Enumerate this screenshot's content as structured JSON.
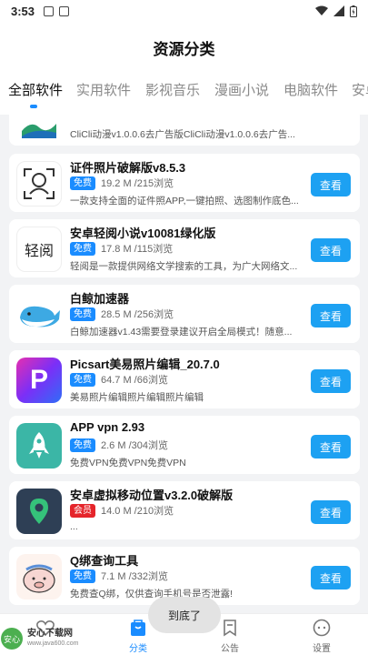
{
  "status_bar": {
    "time": "3:53"
  },
  "header": {
    "title": "资源分类"
  },
  "tabs": [
    {
      "label": "全部软件",
      "active": true
    },
    {
      "label": "实用软件",
      "active": false
    },
    {
      "label": "影视音乐",
      "active": false
    },
    {
      "label": "漫画小说",
      "active": false
    },
    {
      "label": "电脑软件",
      "active": false
    },
    {
      "label": "安卓",
      "active": false
    }
  ],
  "list": {
    "view_label": "查看",
    "partial_top": {
      "desc": "CliCli动漫v1.0.0.6去广告版CliCli动漫v1.0.0.6去广告..."
    },
    "items": [
      {
        "name": "证件照片破解版v8.5.3",
        "badge": "免费",
        "size": "19.2 M /215浏览",
        "desc": "一款支持全面的证件照APP,一键拍照、选图制作底色...",
        "icon": "id-photo-icon"
      },
      {
        "name": "安卓轻阅小说v10081绿化版",
        "badge": "免费",
        "size": "17.8 M /115浏览",
        "desc": "轻阅是一款提供网络文学搜索的工具，为广大网络文...",
        "icon": "reader-icon",
        "icon_text": "轻阅"
      },
      {
        "name": "白鲸加速器",
        "badge": "免费",
        "size": "28.5 M /256浏览",
        "desc": "白鲸加速器v1.43需要登录建议开启全局模式！随意...",
        "icon": "whale-icon"
      },
      {
        "name": "Picsart美易照片编辑_20.7.0",
        "badge": "免费",
        "size": "64.7 M /66浏览",
        "desc": "美易照片编辑照片编辑照片编辑",
        "icon": "picsart-icon",
        "icon_text": "P"
      },
      {
        "name": "APP vpn 2.93",
        "badge": "免费",
        "size": "2.6 M /304浏览",
        "desc": "免费VPN免费VPN免费VPN",
        "icon": "rocket-icon"
      },
      {
        "name": "安卓虚拟移动位置v3.2.0破解版",
        "badge": "会员",
        "size": "14.0 M /210浏览",
        "desc": "...",
        "icon": "location-pin-icon",
        "vip": true
      },
      {
        "name": "Q绑查询工具",
        "badge": "免费",
        "size": "7.1 M /332浏览",
        "desc": "免费查Q绑，仅供查询手机号是否泄露!",
        "icon": "pig-icon"
      }
    ]
  },
  "toast": "到底了",
  "bottom_nav": [
    {
      "label": "",
      "icon": "heart-icon"
    },
    {
      "label": "分类",
      "icon": "bag-icon",
      "active": true
    },
    {
      "label": "公告",
      "icon": "notice-icon"
    },
    {
      "label": "设置",
      "icon": "settings-face-icon"
    }
  ],
  "watermark": {
    "text": "安心下载网",
    "sub": "www.java600.com",
    "logo_text": "安心"
  }
}
